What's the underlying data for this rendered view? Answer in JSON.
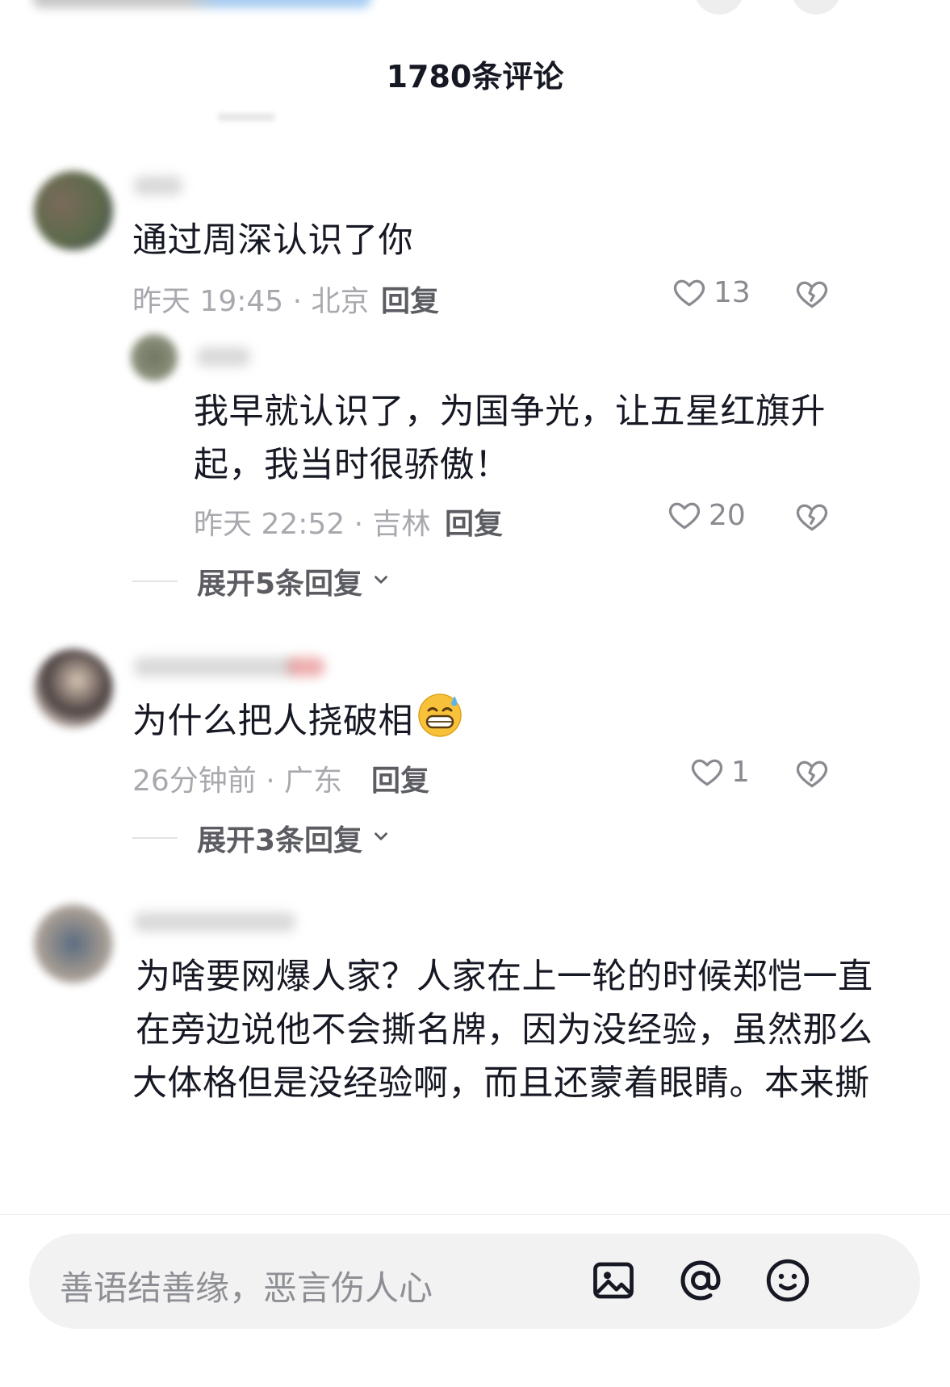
{
  "header": {
    "title": "1780条评论"
  },
  "comments": [
    {
      "text_lines": [
        "通过周深认识了你"
      ],
      "time_location": "昨天 19:45 · 北京",
      "reply_label": "回复",
      "likes": "13",
      "replies": [
        {
          "text_lines": [
            "我早就认识了，为国争光，让五星红旗升",
            "起，我当时很骄傲！"
          ],
          "time_location": "昨天 22:52 · 吉林",
          "reply_label": "回复",
          "likes": "20"
        }
      ],
      "expand_label": "展开5条回复"
    },
    {
      "text_lines": [
        "为什么把人挠破相"
      ],
      "emoji": "grinning-sweat-emoji",
      "time_location": "26分钟前 · 广东",
      "reply_label": "回复",
      "likes": "1",
      "expand_label": "展开3条回复"
    },
    {
      "text_lines": [
        "为啥要网爆人家？人家在上一轮的时候郑恺一直",
        "在旁边说他不会撕名牌，因为没经验，虽然那么",
        "大体格但是没经验啊，而且还蒙着眼睛。本来撕"
      ]
    }
  ],
  "input": {
    "placeholder": "善语结善缘，恶言伤人心",
    "icons": [
      "image-icon",
      "at-icon",
      "emoji-icon"
    ]
  },
  "colors": {
    "text": "#161823",
    "meta": "#a8a9ae",
    "action": "#5c5d63",
    "input_bg": "#f2f2f3"
  }
}
